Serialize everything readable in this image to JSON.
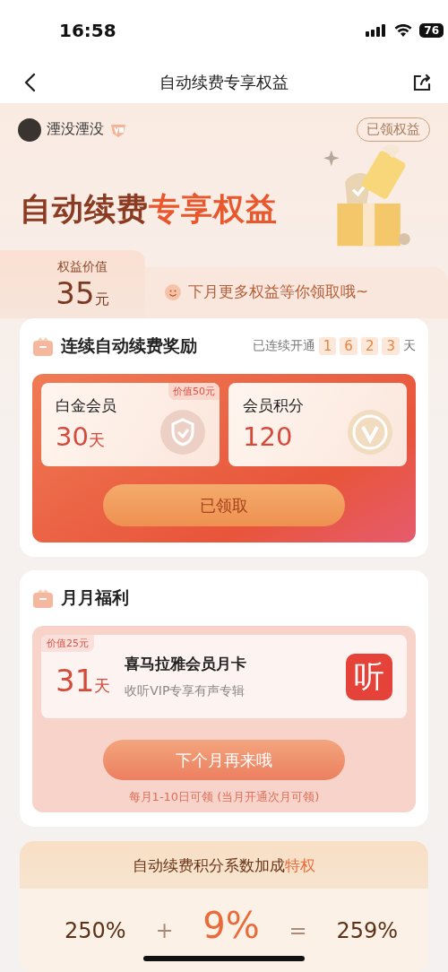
{
  "status_bar": {
    "time": "16:58",
    "battery": "76"
  },
  "nav": {
    "title": "自动续费专享权益"
  },
  "user": {
    "name": "湮没湮没",
    "claimed_button": "已领权益"
  },
  "headline": {
    "dark": "自动续费",
    "accent": "专享权益"
  },
  "value": {
    "label": "权益价值",
    "amount": "35",
    "unit": "元"
  },
  "message": "下月更多权益等你领取哦~",
  "streak_card": {
    "title": "连续自动续费奖励",
    "streak_label": "已连续开通",
    "streak_digits": [
      "1",
      "6",
      "2",
      "3"
    ],
    "streak_unit": "天",
    "rewards": [
      {
        "kind": "shield",
        "name": "白金会员",
        "amount": "30",
        "unit": "天",
        "tag": "价值50元"
      },
      {
        "kind": "coin",
        "name": "会员积分",
        "amount": "120"
      }
    ],
    "button": "已领取"
  },
  "monthly_card": {
    "title": "月月福利",
    "offer": {
      "tag": "价值25元",
      "amount": "31",
      "unit": "天",
      "title": "喜马拉雅会员月卡",
      "subtitle": "收听VIP专享有声专辑",
      "app_icon": "听"
    },
    "button": "下个月再来哦",
    "note": "每月1-10日可领 (当月开通次月可领)"
  },
  "bonus_card": {
    "title": "自动续费积分系数加成",
    "title_accent": "特权",
    "terms": [
      {
        "kind": "value",
        "text": "250%"
      },
      {
        "kind": "operator",
        "text": "+"
      },
      {
        "kind": "bonus",
        "text": "9%"
      },
      {
        "kind": "operator",
        "text": "="
      },
      {
        "kind": "value",
        "text": "259%"
      }
    ]
  }
}
